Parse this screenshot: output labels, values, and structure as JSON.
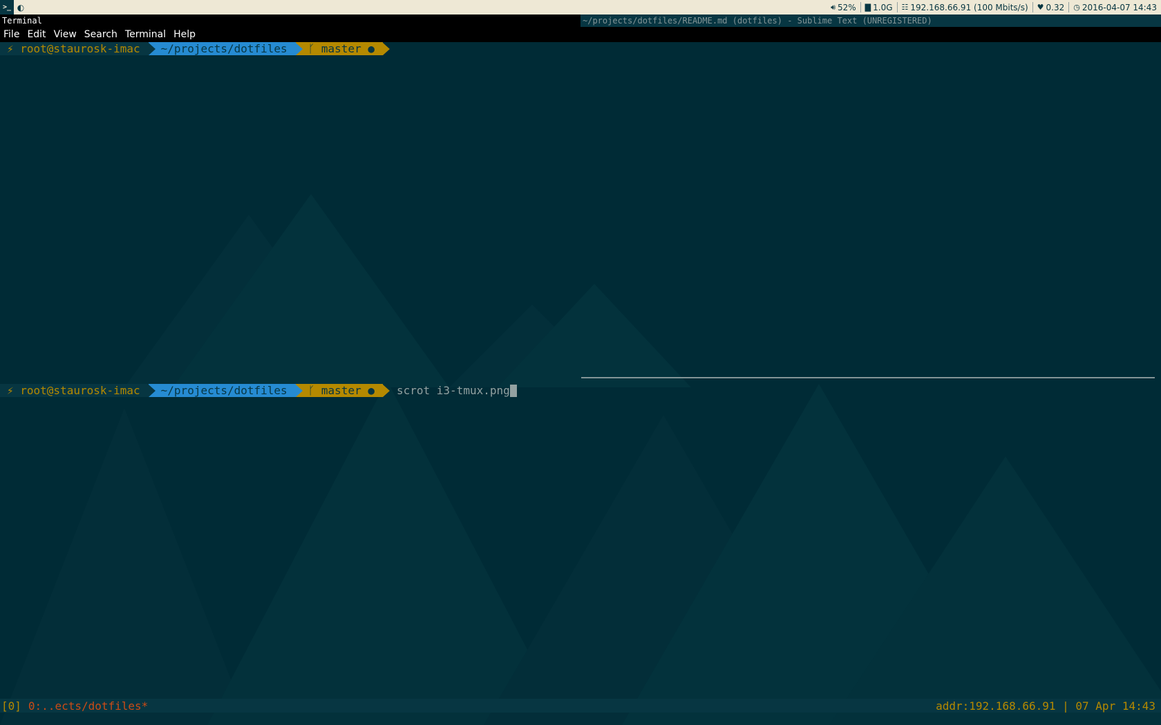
{
  "i3bar": {
    "ws1_icon": ">_",
    "ws2_icon": "◐",
    "volume": "52%",
    "memory": "1.0G",
    "network": "192.168.66.91 (100 Mbits/s)",
    "load": "0.32",
    "clock": "2016-04-07 14:43",
    "icons": [
      "volume-icon",
      "chart-icon",
      "network-icon",
      "heart-icon",
      "clock-icon"
    ]
  },
  "windows": {
    "terminal_title": "Terminal",
    "sublime_title": "~/projects/dotfiles/README.md (dotfiles) - Sublime Text (UNREGISTERED)"
  },
  "menu": {
    "file": "File",
    "edit": "Edit",
    "view": "View",
    "search": "Search",
    "terminal": "Terminal",
    "help": "Help"
  },
  "prompts": [
    {
      "host": "⚡ root@staurosk-imac",
      "dir": "~/projects/dotfiles",
      "git": "ᚴ master ●",
      "command": ""
    },
    {
      "host": "⚡ root@staurosk-imac",
      "dir": "~/projects/dotfiles",
      "git": "ᚴ master ●",
      "command": "scrot i3-tmux.png"
    }
  ],
  "tmux": {
    "session": "[0]",
    "window": "0:..ects/dotfiles*",
    "right": "addr:192.168.66.91  | 07 Apr 14:43"
  },
  "colors": {
    "background": "#002b36",
    "base02": "#073642",
    "yellow": "#b58900",
    "blue": "#268bd2",
    "orange": "#cb4b16",
    "base1": "#93a1a1"
  }
}
